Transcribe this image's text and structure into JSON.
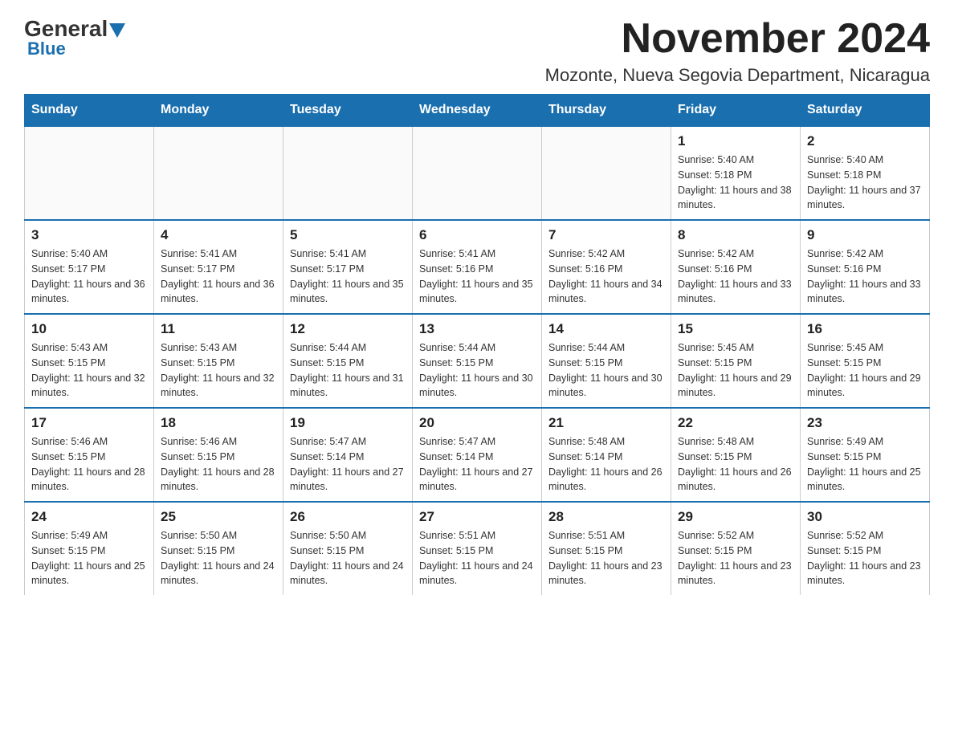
{
  "header": {
    "logo_text": "General",
    "logo_blue": "Blue",
    "month_title": "November 2024",
    "location": "Mozonte, Nueva Segovia Department, Nicaragua"
  },
  "days_of_week": [
    "Sunday",
    "Monday",
    "Tuesday",
    "Wednesday",
    "Thursday",
    "Friday",
    "Saturday"
  ],
  "weeks": [
    [
      {
        "day": "",
        "info": ""
      },
      {
        "day": "",
        "info": ""
      },
      {
        "day": "",
        "info": ""
      },
      {
        "day": "",
        "info": ""
      },
      {
        "day": "",
        "info": ""
      },
      {
        "day": "1",
        "info": "Sunrise: 5:40 AM\nSunset: 5:18 PM\nDaylight: 11 hours and 38 minutes."
      },
      {
        "day": "2",
        "info": "Sunrise: 5:40 AM\nSunset: 5:18 PM\nDaylight: 11 hours and 37 minutes."
      }
    ],
    [
      {
        "day": "3",
        "info": "Sunrise: 5:40 AM\nSunset: 5:17 PM\nDaylight: 11 hours and 36 minutes."
      },
      {
        "day": "4",
        "info": "Sunrise: 5:41 AM\nSunset: 5:17 PM\nDaylight: 11 hours and 36 minutes."
      },
      {
        "day": "5",
        "info": "Sunrise: 5:41 AM\nSunset: 5:17 PM\nDaylight: 11 hours and 35 minutes."
      },
      {
        "day": "6",
        "info": "Sunrise: 5:41 AM\nSunset: 5:16 PM\nDaylight: 11 hours and 35 minutes."
      },
      {
        "day": "7",
        "info": "Sunrise: 5:42 AM\nSunset: 5:16 PM\nDaylight: 11 hours and 34 minutes."
      },
      {
        "day": "8",
        "info": "Sunrise: 5:42 AM\nSunset: 5:16 PM\nDaylight: 11 hours and 33 minutes."
      },
      {
        "day": "9",
        "info": "Sunrise: 5:42 AM\nSunset: 5:16 PM\nDaylight: 11 hours and 33 minutes."
      }
    ],
    [
      {
        "day": "10",
        "info": "Sunrise: 5:43 AM\nSunset: 5:15 PM\nDaylight: 11 hours and 32 minutes."
      },
      {
        "day": "11",
        "info": "Sunrise: 5:43 AM\nSunset: 5:15 PM\nDaylight: 11 hours and 32 minutes."
      },
      {
        "day": "12",
        "info": "Sunrise: 5:44 AM\nSunset: 5:15 PM\nDaylight: 11 hours and 31 minutes."
      },
      {
        "day": "13",
        "info": "Sunrise: 5:44 AM\nSunset: 5:15 PM\nDaylight: 11 hours and 30 minutes."
      },
      {
        "day": "14",
        "info": "Sunrise: 5:44 AM\nSunset: 5:15 PM\nDaylight: 11 hours and 30 minutes."
      },
      {
        "day": "15",
        "info": "Sunrise: 5:45 AM\nSunset: 5:15 PM\nDaylight: 11 hours and 29 minutes."
      },
      {
        "day": "16",
        "info": "Sunrise: 5:45 AM\nSunset: 5:15 PM\nDaylight: 11 hours and 29 minutes."
      }
    ],
    [
      {
        "day": "17",
        "info": "Sunrise: 5:46 AM\nSunset: 5:15 PM\nDaylight: 11 hours and 28 minutes."
      },
      {
        "day": "18",
        "info": "Sunrise: 5:46 AM\nSunset: 5:15 PM\nDaylight: 11 hours and 28 minutes."
      },
      {
        "day": "19",
        "info": "Sunrise: 5:47 AM\nSunset: 5:14 PM\nDaylight: 11 hours and 27 minutes."
      },
      {
        "day": "20",
        "info": "Sunrise: 5:47 AM\nSunset: 5:14 PM\nDaylight: 11 hours and 27 minutes."
      },
      {
        "day": "21",
        "info": "Sunrise: 5:48 AM\nSunset: 5:14 PM\nDaylight: 11 hours and 26 minutes."
      },
      {
        "day": "22",
        "info": "Sunrise: 5:48 AM\nSunset: 5:15 PM\nDaylight: 11 hours and 26 minutes."
      },
      {
        "day": "23",
        "info": "Sunrise: 5:49 AM\nSunset: 5:15 PM\nDaylight: 11 hours and 25 minutes."
      }
    ],
    [
      {
        "day": "24",
        "info": "Sunrise: 5:49 AM\nSunset: 5:15 PM\nDaylight: 11 hours and 25 minutes."
      },
      {
        "day": "25",
        "info": "Sunrise: 5:50 AM\nSunset: 5:15 PM\nDaylight: 11 hours and 24 minutes."
      },
      {
        "day": "26",
        "info": "Sunrise: 5:50 AM\nSunset: 5:15 PM\nDaylight: 11 hours and 24 minutes."
      },
      {
        "day": "27",
        "info": "Sunrise: 5:51 AM\nSunset: 5:15 PM\nDaylight: 11 hours and 24 minutes."
      },
      {
        "day": "28",
        "info": "Sunrise: 5:51 AM\nSunset: 5:15 PM\nDaylight: 11 hours and 23 minutes."
      },
      {
        "day": "29",
        "info": "Sunrise: 5:52 AM\nSunset: 5:15 PM\nDaylight: 11 hours and 23 minutes."
      },
      {
        "day": "30",
        "info": "Sunrise: 5:52 AM\nSunset: 5:15 PM\nDaylight: 11 hours and 23 minutes."
      }
    ]
  ]
}
